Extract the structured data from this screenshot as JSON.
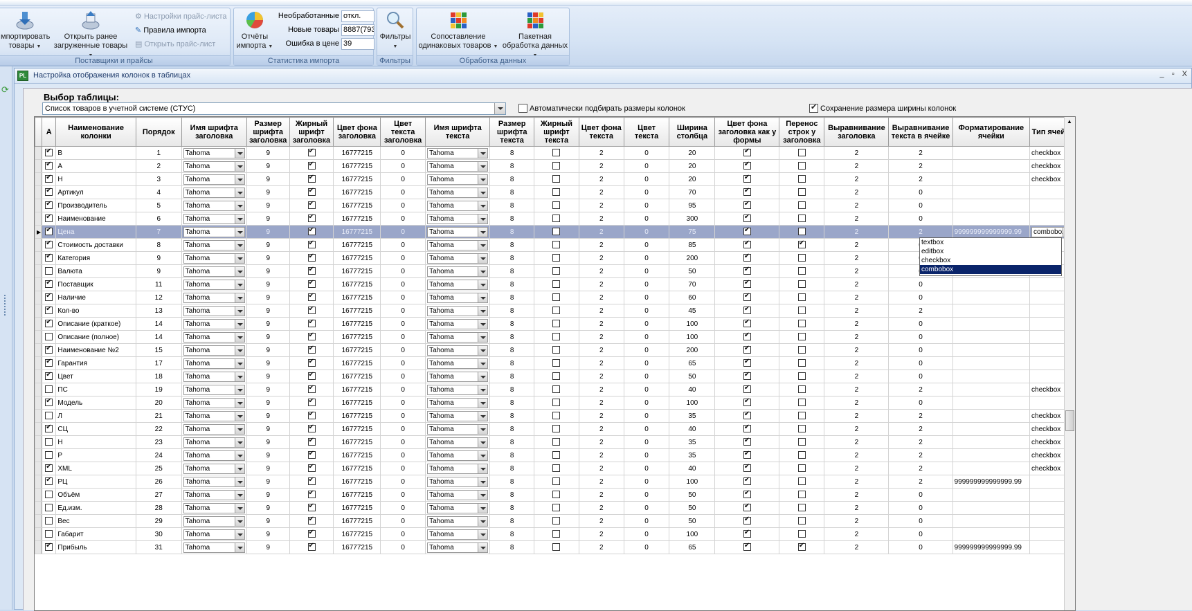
{
  "ribbon": {
    "suppliers": {
      "label": "Поставщики и прайсы",
      "import_goods_line1": "мпортировать",
      "import_goods_line2": "товары",
      "open_loaded_line1": "Открыть ранее",
      "open_loaded_line2": "загруженные товары",
      "price_settings": "Настройки прайс-листа",
      "import_rules": "Правила импорта",
      "open_price": "Открыть прайс-лист"
    },
    "stats": {
      "label": "Статистика импорта",
      "reports_line1": "Отчёты",
      "reports_line2": "импорта",
      "unprocessed_label": "Необработанные",
      "unprocessed_value": "откл.",
      "new_label": "Новые товары",
      "new_value": "8887(793",
      "price_err_label": "Ошибка в цене",
      "price_err_value": "39"
    },
    "filters": {
      "label": "Фильтры",
      "button": "Фильтры"
    },
    "processing": {
      "label": "Обработка данных",
      "match_line1": "Сопоставление",
      "match_line2": "одинаковых товаров",
      "batch_line1": "Пакетная",
      "batch_line2": "обработка данных"
    }
  },
  "window": {
    "icon_text": "PL",
    "title": "Настройка отображения колонок в таблицах",
    "controls": "_ ▫ X"
  },
  "panel": {
    "select_label": "Выбор таблицы:",
    "table_value": "Список товаров в учетной системе (СТУС)",
    "auto_size_label": "Автоматически подбирать размеры колонок",
    "save_width_label": "Сохранение размера ширины колонок"
  },
  "grid": {
    "headers": [
      "A",
      "Наименование колонки",
      "Порядок",
      "Имя шрифта заголовка",
      "Размер шрифта заголовка",
      "Жирный шрифт заголовка",
      "Цвет фона заголовка",
      "Цвет текста заголовка",
      "Имя шрифта текста",
      "Размер шрифта текста",
      "Жирный шрифт текста",
      "Цвет фона текста",
      "Цвет текста",
      "Ширина столбца",
      "Цвет фона заголовка как у формы",
      "Перенос строк у заголовка",
      "Выравнивание заголовка",
      "Выравнивание текста в ячейке",
      "Форматирование ячейки",
      "Тип ячейки"
    ],
    "rows": [
      {
        "a": true,
        "name": "В",
        "order": "1",
        "hfont": "Tahoma",
        "hsize": "9",
        "hbold": true,
        "hbg": "16777215",
        "hcolor": "0",
        "tfont": "Tahoma",
        "tsize": "8",
        "tbold": false,
        "tbg": "2",
        "tcolor": "0",
        "width": "20",
        "formbg": true,
        "wrap": false,
        "halign": "2",
        "talign": "2",
        "format": "",
        "type": "checkbox"
      },
      {
        "a": true,
        "name": "А",
        "order": "2",
        "hfont": "Tahoma",
        "hsize": "9",
        "hbold": true,
        "hbg": "16777215",
        "hcolor": "0",
        "tfont": "Tahoma",
        "tsize": "8",
        "tbold": false,
        "tbg": "2",
        "tcolor": "0",
        "width": "20",
        "formbg": true,
        "wrap": false,
        "halign": "2",
        "talign": "2",
        "format": "",
        "type": "checkbox"
      },
      {
        "a": true,
        "name": "Н",
        "order": "3",
        "hfont": "Tahoma",
        "hsize": "9",
        "hbold": true,
        "hbg": "16777215",
        "hcolor": "0",
        "tfont": "Tahoma",
        "tsize": "8",
        "tbold": false,
        "tbg": "2",
        "tcolor": "0",
        "width": "20",
        "formbg": true,
        "wrap": false,
        "halign": "2",
        "talign": "2",
        "format": "",
        "type": "checkbox"
      },
      {
        "a": true,
        "name": "Артикул",
        "order": "4",
        "hfont": "Tahoma",
        "hsize": "9",
        "hbold": true,
        "hbg": "16777215",
        "hcolor": "0",
        "tfont": "Tahoma",
        "tsize": "8",
        "tbold": false,
        "tbg": "2",
        "tcolor": "0",
        "width": "70",
        "formbg": true,
        "wrap": false,
        "halign": "2",
        "talign": "0",
        "format": "",
        "type": ""
      },
      {
        "a": true,
        "name": "Производитель",
        "order": "5",
        "hfont": "Tahoma",
        "hsize": "9",
        "hbold": true,
        "hbg": "16777215",
        "hcolor": "0",
        "tfont": "Tahoma",
        "tsize": "8",
        "tbold": false,
        "tbg": "2",
        "tcolor": "0",
        "width": "95",
        "formbg": true,
        "wrap": false,
        "halign": "2",
        "talign": "0",
        "format": "",
        "type": ""
      },
      {
        "a": true,
        "name": "Наименование",
        "order": "6",
        "hfont": "Tahoma",
        "hsize": "9",
        "hbold": true,
        "hbg": "16777215",
        "hcolor": "0",
        "tfont": "Tahoma",
        "tsize": "8",
        "tbold": false,
        "tbg": "2",
        "tcolor": "0",
        "width": "300",
        "formbg": true,
        "wrap": false,
        "halign": "2",
        "talign": "0",
        "format": "",
        "type": ""
      },
      {
        "a": true,
        "name": "Цена",
        "order": "7",
        "hfont": "Tahoma",
        "hsize": "9",
        "hbold": true,
        "hbg": "16777215",
        "hcolor": "0",
        "tfont": "Tahoma",
        "tsize": "8",
        "tbold": false,
        "tbg": "2",
        "tcolor": "0",
        "width": "75",
        "formbg": true,
        "wrap": false,
        "halign": "2",
        "talign": "2",
        "format": "999999999999999.99",
        "type": "combobox",
        "current": true
      },
      {
        "a": true,
        "name": "Стоимость доставки",
        "order": "8",
        "hfont": "Tahoma",
        "hsize": "9",
        "hbold": true,
        "hbg": "16777215",
        "hcolor": "0",
        "tfont": "Tahoma",
        "tsize": "8",
        "tbold": false,
        "tbg": "2",
        "tcolor": "0",
        "width": "85",
        "formbg": true,
        "wrap": true,
        "halign": "2",
        "talign": "0",
        "format": "",
        "type": ""
      },
      {
        "a": true,
        "name": "Категория",
        "order": "9",
        "hfont": "Tahoma",
        "hsize": "9",
        "hbold": true,
        "hbg": "16777215",
        "hcolor": "0",
        "tfont": "Tahoma",
        "tsize": "8",
        "tbold": false,
        "tbg": "2",
        "tcolor": "0",
        "width": "200",
        "formbg": true,
        "wrap": false,
        "halign": "2",
        "talign": "0",
        "format": "",
        "type": ""
      },
      {
        "a": false,
        "name": "Валюта",
        "order": "9",
        "hfont": "Tahoma",
        "hsize": "9",
        "hbold": true,
        "hbg": "16777215",
        "hcolor": "0",
        "tfont": "Tahoma",
        "tsize": "8",
        "tbold": false,
        "tbg": "2",
        "tcolor": "0",
        "width": "50",
        "formbg": true,
        "wrap": false,
        "halign": "2",
        "talign": "0",
        "format": "",
        "type": ""
      },
      {
        "a": true,
        "name": "Поставщик",
        "order": "11",
        "hfont": "Tahoma",
        "hsize": "9",
        "hbold": true,
        "hbg": "16777215",
        "hcolor": "0",
        "tfont": "Tahoma",
        "tsize": "8",
        "tbold": false,
        "tbg": "2",
        "tcolor": "0",
        "width": "70",
        "formbg": true,
        "wrap": false,
        "halign": "2",
        "talign": "0",
        "format": "",
        "type": ""
      },
      {
        "a": true,
        "name": "Наличие",
        "order": "12",
        "hfont": "Tahoma",
        "hsize": "9",
        "hbold": true,
        "hbg": "16777215",
        "hcolor": "0",
        "tfont": "Tahoma",
        "tsize": "8",
        "tbold": false,
        "tbg": "2",
        "tcolor": "0",
        "width": "60",
        "formbg": true,
        "wrap": false,
        "halign": "2",
        "talign": "0",
        "format": "",
        "type": ""
      },
      {
        "a": true,
        "name": "Кол-во",
        "order": "13",
        "hfont": "Tahoma",
        "hsize": "9",
        "hbold": true,
        "hbg": "16777215",
        "hcolor": "0",
        "tfont": "Tahoma",
        "tsize": "8",
        "tbold": false,
        "tbg": "2",
        "tcolor": "0",
        "width": "45",
        "formbg": true,
        "wrap": false,
        "halign": "2",
        "talign": "2",
        "format": "",
        "type": ""
      },
      {
        "a": true,
        "name": "Описание (краткое)",
        "order": "14",
        "hfont": "Tahoma",
        "hsize": "9",
        "hbold": true,
        "hbg": "16777215",
        "hcolor": "0",
        "tfont": "Tahoma",
        "tsize": "8",
        "tbold": false,
        "tbg": "2",
        "tcolor": "0",
        "width": "100",
        "formbg": true,
        "wrap": false,
        "halign": "2",
        "talign": "0",
        "format": "",
        "type": ""
      },
      {
        "a": false,
        "name": "Описание (полное)",
        "order": "14",
        "hfont": "Tahoma",
        "hsize": "9",
        "hbold": true,
        "hbg": "16777215",
        "hcolor": "0",
        "tfont": "Tahoma",
        "tsize": "8",
        "tbold": false,
        "tbg": "2",
        "tcolor": "0",
        "width": "100",
        "formbg": true,
        "wrap": false,
        "halign": "2",
        "talign": "0",
        "format": "",
        "type": ""
      },
      {
        "a": true,
        "name": "Наименование №2",
        "order": "15",
        "hfont": "Tahoma",
        "hsize": "9",
        "hbold": true,
        "hbg": "16777215",
        "hcolor": "0",
        "tfont": "Tahoma",
        "tsize": "8",
        "tbold": false,
        "tbg": "2",
        "tcolor": "0",
        "width": "200",
        "formbg": true,
        "wrap": false,
        "halign": "2",
        "talign": "0",
        "format": "",
        "type": ""
      },
      {
        "a": true,
        "name": "Гарантия",
        "order": "17",
        "hfont": "Tahoma",
        "hsize": "9",
        "hbold": true,
        "hbg": "16777215",
        "hcolor": "0",
        "tfont": "Tahoma",
        "tsize": "8",
        "tbold": false,
        "tbg": "2",
        "tcolor": "0",
        "width": "65",
        "formbg": true,
        "wrap": false,
        "halign": "2",
        "talign": "0",
        "format": "",
        "type": ""
      },
      {
        "a": true,
        "name": "Цвет",
        "order": "18",
        "hfont": "Tahoma",
        "hsize": "9",
        "hbold": true,
        "hbg": "16777215",
        "hcolor": "0",
        "tfont": "Tahoma",
        "tsize": "8",
        "tbold": false,
        "tbg": "2",
        "tcolor": "0",
        "width": "50",
        "formbg": true,
        "wrap": false,
        "halign": "2",
        "talign": "0",
        "format": "",
        "type": ""
      },
      {
        "a": false,
        "name": "ПС",
        "order": "19",
        "hfont": "Tahoma",
        "hsize": "9",
        "hbold": true,
        "hbg": "16777215",
        "hcolor": "0",
        "tfont": "Tahoma",
        "tsize": "8",
        "tbold": false,
        "tbg": "2",
        "tcolor": "0",
        "width": "40",
        "formbg": true,
        "wrap": false,
        "halign": "2",
        "talign": "2",
        "format": "",
        "type": "checkbox"
      },
      {
        "a": true,
        "name": "Модель",
        "order": "20",
        "hfont": "Tahoma",
        "hsize": "9",
        "hbold": true,
        "hbg": "16777215",
        "hcolor": "0",
        "tfont": "Tahoma",
        "tsize": "8",
        "tbold": false,
        "tbg": "2",
        "tcolor": "0",
        "width": "100",
        "formbg": true,
        "wrap": false,
        "halign": "2",
        "talign": "0",
        "format": "",
        "type": ""
      },
      {
        "a": false,
        "name": "Л",
        "order": "21",
        "hfont": "Tahoma",
        "hsize": "9",
        "hbold": true,
        "hbg": "16777215",
        "hcolor": "0",
        "tfont": "Tahoma",
        "tsize": "8",
        "tbold": false,
        "tbg": "2",
        "tcolor": "0",
        "width": "35",
        "formbg": true,
        "wrap": false,
        "halign": "2",
        "talign": "2",
        "format": "",
        "type": "checkbox"
      },
      {
        "a": true,
        "name": "СЦ",
        "order": "22",
        "hfont": "Tahoma",
        "hsize": "9",
        "hbold": true,
        "hbg": "16777215",
        "hcolor": "0",
        "tfont": "Tahoma",
        "tsize": "8",
        "tbold": false,
        "tbg": "2",
        "tcolor": "0",
        "width": "40",
        "formbg": true,
        "wrap": false,
        "halign": "2",
        "talign": "2",
        "format": "",
        "type": "checkbox"
      },
      {
        "a": false,
        "name": "Н",
        "order": "23",
        "hfont": "Tahoma",
        "hsize": "9",
        "hbold": true,
        "hbg": "16777215",
        "hcolor": "0",
        "tfont": "Tahoma",
        "tsize": "8",
        "tbold": false,
        "tbg": "2",
        "tcolor": "0",
        "width": "35",
        "formbg": true,
        "wrap": false,
        "halign": "2",
        "talign": "2",
        "format": "",
        "type": "checkbox"
      },
      {
        "a": false,
        "name": "Р",
        "order": "24",
        "hfont": "Tahoma",
        "hsize": "9",
        "hbold": true,
        "hbg": "16777215",
        "hcolor": "0",
        "tfont": "Tahoma",
        "tsize": "8",
        "tbold": false,
        "tbg": "2",
        "tcolor": "0",
        "width": "35",
        "formbg": true,
        "wrap": false,
        "halign": "2",
        "talign": "2",
        "format": "",
        "type": "checkbox"
      },
      {
        "a": true,
        "name": "XML",
        "order": "25",
        "hfont": "Tahoma",
        "hsize": "9",
        "hbold": true,
        "hbg": "16777215",
        "hcolor": "0",
        "tfont": "Tahoma",
        "tsize": "8",
        "tbold": false,
        "tbg": "2",
        "tcolor": "0",
        "width": "40",
        "formbg": true,
        "wrap": false,
        "halign": "2",
        "talign": "2",
        "format": "",
        "type": "checkbox"
      },
      {
        "a": true,
        "name": "РЦ",
        "order": "26",
        "hfont": "Tahoma",
        "hsize": "9",
        "hbold": true,
        "hbg": "16777215",
        "hcolor": "0",
        "tfont": "Tahoma",
        "tsize": "8",
        "tbold": false,
        "tbg": "2",
        "tcolor": "0",
        "width": "100",
        "formbg": true,
        "wrap": false,
        "halign": "2",
        "talign": "2",
        "format": "999999999999999.99",
        "type": ""
      },
      {
        "a": false,
        "name": "Объём",
        "order": "27",
        "hfont": "Tahoma",
        "hsize": "9",
        "hbold": true,
        "hbg": "16777215",
        "hcolor": "0",
        "tfont": "Tahoma",
        "tsize": "8",
        "tbold": false,
        "tbg": "2",
        "tcolor": "0",
        "width": "50",
        "formbg": true,
        "wrap": false,
        "halign": "2",
        "talign": "0",
        "format": "",
        "type": ""
      },
      {
        "a": false,
        "name": "Ед.изм.",
        "order": "28",
        "hfont": "Tahoma",
        "hsize": "9",
        "hbold": true,
        "hbg": "16777215",
        "hcolor": "0",
        "tfont": "Tahoma",
        "tsize": "8",
        "tbold": false,
        "tbg": "2",
        "tcolor": "0",
        "width": "50",
        "formbg": true,
        "wrap": false,
        "halign": "2",
        "talign": "0",
        "format": "",
        "type": ""
      },
      {
        "a": false,
        "name": "Вес",
        "order": "29",
        "hfont": "Tahoma",
        "hsize": "9",
        "hbold": true,
        "hbg": "16777215",
        "hcolor": "0",
        "tfont": "Tahoma",
        "tsize": "8",
        "tbold": false,
        "tbg": "2",
        "tcolor": "0",
        "width": "50",
        "formbg": true,
        "wrap": false,
        "halign": "2",
        "talign": "0",
        "format": "",
        "type": ""
      },
      {
        "a": false,
        "name": "Габарит",
        "order": "30",
        "hfont": "Tahoma",
        "hsize": "9",
        "hbold": true,
        "hbg": "16777215",
        "hcolor": "0",
        "tfont": "Tahoma",
        "tsize": "8",
        "tbold": false,
        "tbg": "2",
        "tcolor": "0",
        "width": "100",
        "formbg": true,
        "wrap": false,
        "halign": "2",
        "talign": "0",
        "format": "",
        "type": ""
      },
      {
        "a": true,
        "name": "Прибыль",
        "order": "31",
        "hfont": "Tahoma",
        "hsize": "9",
        "hbold": true,
        "hbg": "16777215",
        "hcolor": "0",
        "tfont": "Tahoma",
        "tsize": "8",
        "tbold": false,
        "tbg": "2",
        "tcolor": "0",
        "width": "65",
        "formbg": true,
        "wrap": true,
        "halign": "2",
        "talign": "0",
        "format": "999999999999999.99",
        "type": ""
      }
    ]
  },
  "dropdown": {
    "options": [
      "textbox",
      "editbox",
      "checkbox",
      "combobox"
    ],
    "selected": "combobox"
  },
  "colors": {
    "ribbon_bg": "#d5e3f4",
    "current_row": "#9aa6c9",
    "dropdown_highlight": "#0a246a"
  }
}
